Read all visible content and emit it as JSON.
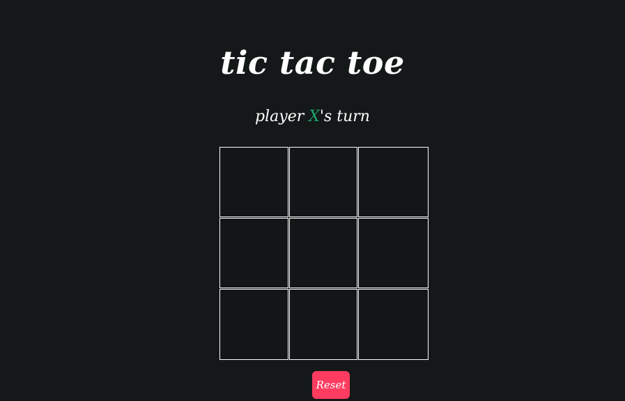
{
  "title": "tic tac toe",
  "status": {
    "prefix": "player ",
    "player": "X",
    "suffix": "'s turn"
  },
  "board": {
    "cells": [
      "",
      "",
      "",
      "",
      "",
      "",
      "",
      "",
      ""
    ]
  },
  "reset_label": "Reset",
  "colors": {
    "background": "#141819",
    "player_x": "#1fa36b",
    "reset_button": "#ff3b60",
    "grid_lines": "#ffffff"
  }
}
